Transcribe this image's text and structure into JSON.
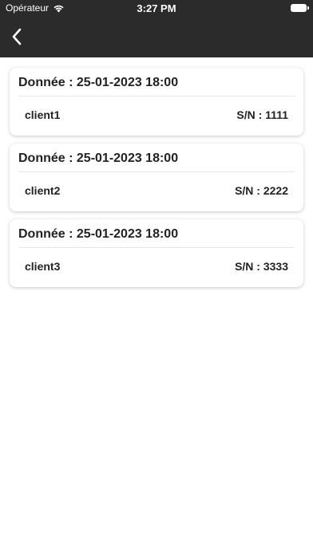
{
  "status_bar": {
    "carrier": "Opérateur",
    "time": "3:27 PM"
  },
  "nav": {
    "back_icon": "chevron-left-icon"
  },
  "colors": {
    "header_bg": "#2b2b2b",
    "text": "#222222"
  },
  "records": [
    {
      "title": "Donnée : 25-01-2023 18:00",
      "client": "client1",
      "serial": "S/N : 1111"
    },
    {
      "title": "Donnée : 25-01-2023 18:00",
      "client": "client2",
      "serial": "S/N : 2222"
    },
    {
      "title": "Donnée : 25-01-2023 18:00",
      "client": "client3",
      "serial": "S/N : 3333"
    }
  ]
}
